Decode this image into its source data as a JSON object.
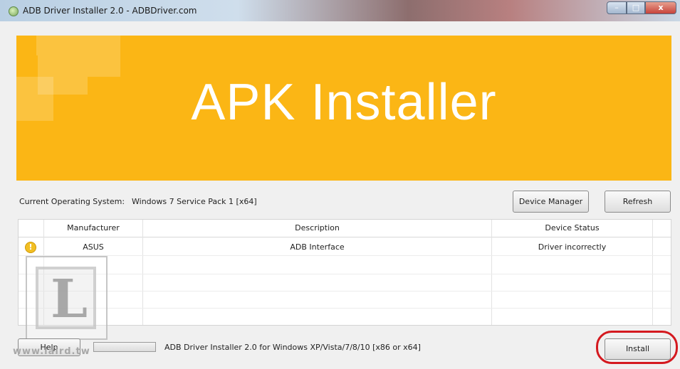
{
  "window": {
    "title": "ADB Driver Installer 2.0 - ADBDriver.com",
    "minimize_glyph": "–",
    "maximize_glyph": "□",
    "close_glyph": "x"
  },
  "banner": {
    "title": "APK Installer",
    "color": "#fbb615"
  },
  "system": {
    "label": "Current Operating System:",
    "value": "Windows 7 Service Pack 1 [x64]"
  },
  "buttons": {
    "device_manager": "Device Manager",
    "refresh": "Refresh",
    "help": "Help",
    "install": "Install"
  },
  "table": {
    "columns": [
      "Manufacturer",
      "Description",
      "Device Status"
    ],
    "rows": [
      {
        "icon": "warning-icon",
        "icon_glyph": "!",
        "manufacturer": "ASUS",
        "description": "ADB Interface",
        "status": "Driver incorrectly"
      }
    ]
  },
  "footer": {
    "status_text": "ADB Driver Installer 2.0 for Windows XP/Vista/7/8/10 [x86 or x64]",
    "progress": 0
  },
  "watermark": {
    "letter": "L",
    "url": "www.laird.tw"
  },
  "colors": {
    "highlight": "#d4191f",
    "warning": "#f2bf24"
  }
}
